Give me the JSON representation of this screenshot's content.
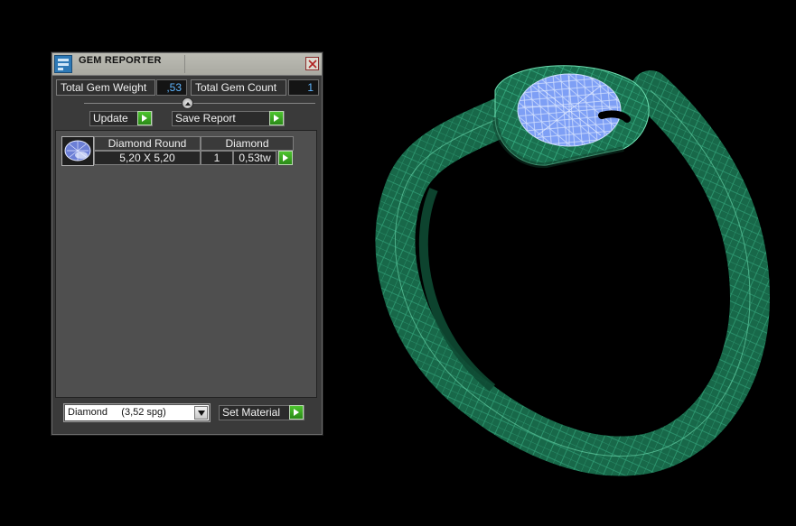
{
  "window": {
    "title": "GEM REPORTER",
    "icon": "gem-reporter-app-icon",
    "close_icon": "close-icon"
  },
  "summary": {
    "weight_label": "Total Gem Weight",
    "weight_value": ",53",
    "count_label": "Total Gem Count",
    "count_value": "1"
  },
  "actions": {
    "update_label": "Update",
    "save_label": "Save Report"
  },
  "gem_table": {
    "headers": [
      "Diamond Round",
      "Diamond"
    ],
    "rows": [
      {
        "size": "5,20 X 5,20",
        "quantity": "1",
        "weight": "0,53tw",
        "icon": "round-gem-icon"
      }
    ]
  },
  "material": {
    "selected": "Diamond     (3,52 spg)",
    "set_label": "Set Material"
  },
  "colors": {
    "panel_bg": "#3a3a3a",
    "list_bg": "#4f4f4f",
    "value_text": "#5fb6ff",
    "go_button": "#3aa922",
    "ring_mesh": "#1d7c58",
    "gem_mesh": "#8fb2ff"
  },
  "viewport": {
    "model": "ring-wireframe",
    "gem": "diamond-round-wireframe"
  }
}
